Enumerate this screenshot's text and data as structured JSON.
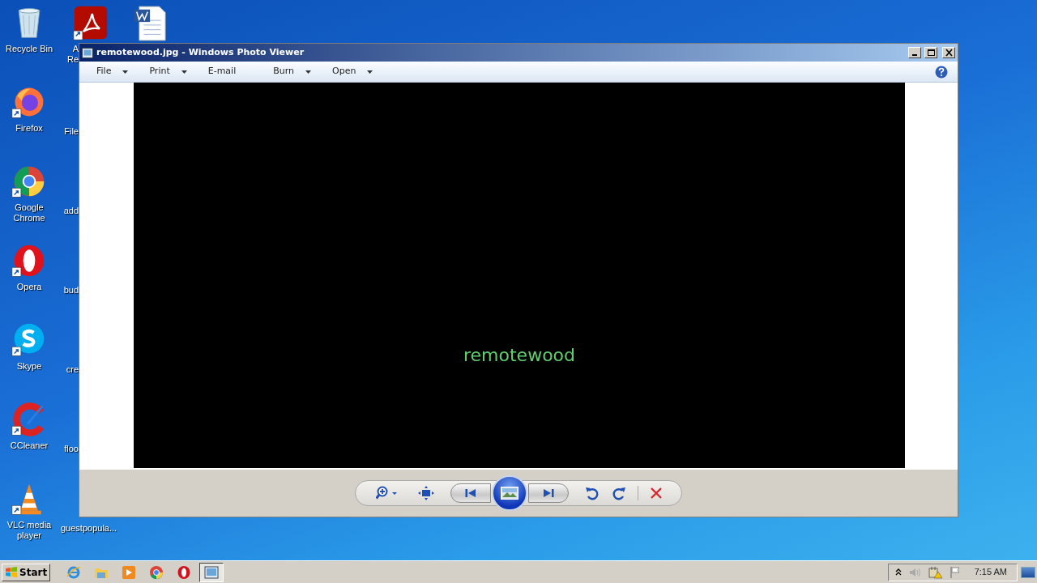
{
  "desktop": {
    "icons": [
      {
        "lines": [
          "Recycle Bin"
        ],
        "kind": "recycle-bin"
      },
      {
        "lines": [
          "Firefox"
        ],
        "kind": "firefox"
      },
      {
        "lines": [
          "Google",
          "Chrome"
        ],
        "kind": "chrome"
      },
      {
        "lines": [
          "Opera"
        ],
        "kind": "opera"
      },
      {
        "lines": [
          "Skype"
        ],
        "kind": "skype"
      },
      {
        "lines": [
          "CCleaner"
        ],
        "kind": "ccleaner"
      },
      {
        "lines": [
          "VLC media",
          "player"
        ],
        "kind": "vlc"
      }
    ],
    "second_column": [
      {
        "lines": [
          "A",
          "Re"
        ],
        "kind": "acrobat",
        "clipped": true
      },
      {
        "lines": [
          "File"
        ],
        "kind": "none",
        "clipped": true
      },
      {
        "lines": [
          "add"
        ],
        "kind": "none",
        "clipped": true
      },
      {
        "lines": [
          "bud"
        ],
        "kind": "none",
        "clipped": true
      },
      {
        "lines": [
          "cre"
        ],
        "kind": "none",
        "clipped": true
      },
      {
        "lines": [
          "floo"
        ],
        "kind": "none",
        "clipped": true
      },
      {
        "lines": [
          "guestpopula..."
        ],
        "kind": "none",
        "clipped": false
      }
    ],
    "top_extra": [
      {
        "kind": "word"
      }
    ]
  },
  "window": {
    "title": "remotewood.jpg - Windows Photo Viewer",
    "menu": [
      {
        "label": "File",
        "dropdown": true
      },
      {
        "label": "Print",
        "dropdown": true
      },
      {
        "label": "E-mail",
        "dropdown": false
      },
      {
        "label": "Burn",
        "dropdown": true
      },
      {
        "label": "Open",
        "dropdown": true
      }
    ],
    "image_text": "remotewood"
  },
  "taskbar": {
    "start": "Start",
    "apps": [
      {
        "kind": "ie",
        "selected": false
      },
      {
        "kind": "folder",
        "selected": false
      },
      {
        "kind": "media",
        "selected": false
      },
      {
        "kind": "chrome",
        "selected": false
      },
      {
        "kind": "opera",
        "selected": false
      },
      {
        "kind": "photo",
        "selected": true
      }
    ],
    "clock": "7:15 AM"
  }
}
